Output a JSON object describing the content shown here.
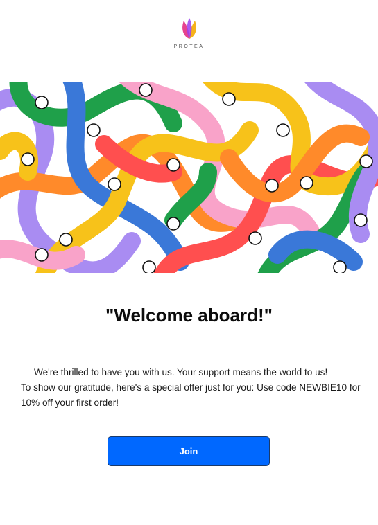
{
  "brand": {
    "logo_text": "PROTEA",
    "colors": [
      "#e6438f",
      "#9b3ef0",
      "#f6b21a"
    ]
  },
  "hero": {
    "icon": "colorful-arms-illustration",
    "colors": [
      "#ff8a2a",
      "#f7c21a",
      "#1fa04a",
      "#3a78d8",
      "#f9a3c9",
      "#ff4f4f",
      "#a98cf2"
    ]
  },
  "headline": "\"Welcome aboard!\"",
  "body": {
    "line1": "We're thrilled to have you with us. Your support means the world to us!",
    "line2": "To show our gratitude, here's a special offer just for you: Use code NEWBIE10 for 10% off your first order!"
  },
  "cta": {
    "label": "Join",
    "color": "#0068ff"
  }
}
